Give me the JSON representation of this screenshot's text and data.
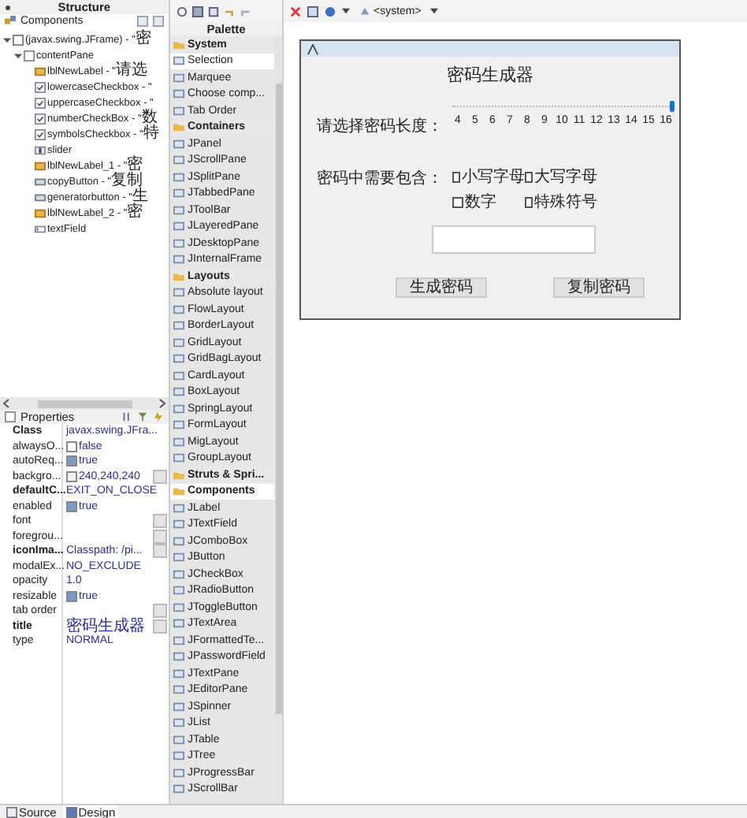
{
  "structure": {
    "title": "Structure",
    "components_label": "Components",
    "tree": [
      {
        "kind": "frame",
        "name": "(javax.swing.JFrame) - \"",
        "text": "密",
        "expanded": true,
        "children": [
          {
            "kind": "panel",
            "name": "contentPane",
            "expanded": true,
            "children": [
              {
                "kind": "label",
                "name": "lblNewLabel - \"",
                "text": "请选"
              },
              {
                "kind": "checkbox",
                "name": "lowercaseCheckbox - \""
              },
              {
                "kind": "checkbox",
                "name": "uppercaseCheckbox - \""
              },
              {
                "kind": "checkbox",
                "name": "numberCheckBox - \"",
                "text": "数"
              },
              {
                "kind": "checkbox",
                "name": "symbolsCheckbox - \"",
                "text": "特"
              },
              {
                "kind": "slider",
                "name": "slider"
              },
              {
                "kind": "label",
                "name": "lblNewLabel_1 - \"",
                "text": "密"
              },
              {
                "kind": "button",
                "name": "copyButton - \"",
                "text": "复制"
              },
              {
                "kind": "button",
                "name": "generatorbutton - \"",
                "text": "生"
              },
              {
                "kind": "label",
                "name": "lblNewLabel_2 - \"",
                "text": "密"
              },
              {
                "kind": "textfield",
                "name": "textField"
              }
            ]
          }
        ]
      }
    ]
  },
  "properties": {
    "title": "Properties",
    "rows": [
      {
        "name": "Class",
        "value": "javax.swing.JFra...",
        "bold": true,
        "kind": "text",
        "button": false
      },
      {
        "name": "alwaysO...",
        "value": "false",
        "bold": false,
        "kind": "check",
        "checked": false,
        "button": false
      },
      {
        "name": "autoReq...",
        "value": "true",
        "bold": false,
        "kind": "check",
        "checked": true,
        "button": false
      },
      {
        "name": "backgro...",
        "value": "240,240,240",
        "bold": false,
        "kind": "color",
        "button": true
      },
      {
        "name": "defaultC...",
        "value": "EXIT_ON_CLOSE",
        "bold": true,
        "kind": "text",
        "button": false
      },
      {
        "name": "enabled",
        "value": "true",
        "bold": false,
        "kind": "check",
        "checked": true,
        "button": false
      },
      {
        "name": "font",
        "bold": false,
        "kind": "text",
        "button": true
      },
      {
        "name": "foregrou...",
        "bold": false,
        "kind": "text",
        "button": true
      },
      {
        "name": "iconIma...",
        "value": "Classpath: /pi...",
        "bold": true,
        "kind": "text",
        "button": true
      },
      {
        "name": "modalEx...",
        "value": "NO_EXCLUDE",
        "bold": false,
        "kind": "text",
        "button": false
      },
      {
        "name": "opacity",
        "value": "1.0",
        "bold": false,
        "kind": "text",
        "button": false
      },
      {
        "name": "resizable",
        "value": "true",
        "bold": false,
        "kind": "check",
        "checked": true,
        "button": false
      },
      {
        "name": "tab order",
        "bold": false,
        "kind": "text",
        "button": true
      },
      {
        "name": "title",
        "value": "密码生成器",
        "bold": true,
        "kind": "text",
        "button": true
      },
      {
        "name": "type",
        "value": "NORMAL",
        "bold": false,
        "kind": "text",
        "button": false
      }
    ]
  },
  "palette": {
    "title": "Palette",
    "items": [
      {
        "kind": "category",
        "label": "System",
        "selected": false
      },
      {
        "kind": "tool",
        "label": "Selection",
        "selected": true
      },
      {
        "kind": "tool",
        "label": "Marquee",
        "selected": false
      },
      {
        "kind": "tool",
        "label": "Choose comp...",
        "selected": false
      },
      {
        "kind": "tool",
        "label": "Tab Order",
        "selected": false
      },
      {
        "kind": "category",
        "label": "Containers",
        "selected": false
      },
      {
        "kind": "tool",
        "label": "JPanel",
        "selected": false
      },
      {
        "kind": "tool",
        "label": "JScrollPane",
        "selected": false
      },
      {
        "kind": "tool",
        "label": "JSplitPane",
        "selected": false
      },
      {
        "kind": "tool",
        "label": "JTabbedPane",
        "selected": false
      },
      {
        "kind": "tool",
        "label": "JToolBar",
        "selected": false
      },
      {
        "kind": "tool",
        "label": "JLayeredPane",
        "selected": false
      },
      {
        "kind": "tool",
        "label": "JDesktopPane",
        "selected": false
      },
      {
        "kind": "tool",
        "label": "JInternalFrame",
        "selected": false
      },
      {
        "kind": "category",
        "label": "Layouts",
        "selected": false
      },
      {
        "kind": "tool",
        "label": "Absolute layout",
        "selected": false
      },
      {
        "kind": "tool",
        "label": "FlowLayout",
        "selected": false
      },
      {
        "kind": "tool",
        "label": "BorderLayout",
        "selected": false
      },
      {
        "kind": "tool",
        "label": "GridLayout",
        "selected": false
      },
      {
        "kind": "tool",
        "label": "GridBagLayout",
        "selected": false
      },
      {
        "kind": "tool",
        "label": "CardLayout",
        "selected": false
      },
      {
        "kind": "tool",
        "label": "BoxLayout",
        "selected": false
      },
      {
        "kind": "tool",
        "label": "SpringLayout",
        "selected": false
      },
      {
        "kind": "tool",
        "label": "FormLayout",
        "selected": false
      },
      {
        "kind": "tool",
        "label": "MigLayout",
        "selected": false
      },
      {
        "kind": "tool",
        "label": "GroupLayout",
        "selected": false
      },
      {
        "kind": "category",
        "label": "Struts & Spri...",
        "selected": false
      },
      {
        "kind": "category",
        "label": "Components",
        "selected": true
      },
      {
        "kind": "tool",
        "label": "JLabel",
        "selected": false
      },
      {
        "kind": "tool",
        "label": "JTextField",
        "selected": false
      },
      {
        "kind": "tool",
        "label": "JComboBox",
        "selected": false
      },
      {
        "kind": "tool",
        "label": "JButton",
        "selected": false
      },
      {
        "kind": "tool",
        "label": "JCheckBox",
        "selected": false
      },
      {
        "kind": "tool",
        "label": "JRadioButton",
        "selected": false
      },
      {
        "kind": "tool",
        "label": "JToggleButton",
        "selected": false
      },
      {
        "kind": "tool",
        "label": "JTextArea",
        "selected": false
      },
      {
        "kind": "tool",
        "label": "JFormattedTe...",
        "selected": false
      },
      {
        "kind": "tool",
        "label": "JPasswordField",
        "selected": false
      },
      {
        "kind": "tool",
        "label": "JTextPane",
        "selected": false
      },
      {
        "kind": "tool",
        "label": "JEditorPane",
        "selected": false
      },
      {
        "kind": "tool",
        "label": "JSpinner",
        "selected": false
      },
      {
        "kind": "tool",
        "label": "JList",
        "selected": false
      },
      {
        "kind": "tool",
        "label": "JTable",
        "selected": false
      },
      {
        "kind": "tool",
        "label": "JTree",
        "selected": false
      },
      {
        "kind": "tool",
        "label": "JProgressBar",
        "selected": false
      },
      {
        "kind": "tool",
        "label": "JScrollBar",
        "selected": false
      }
    ]
  },
  "toolbar": {
    "lookandfeel": "<system>"
  },
  "design": {
    "title": "密码生成器",
    "length_label": "请选择密码长度：",
    "slider": {
      "level": 1.0,
      "ticks": [
        "4",
        "5",
        "6",
        "7",
        "8",
        "9",
        "10",
        "11",
        "12",
        "13",
        "14",
        "15",
        "16"
      ]
    },
    "include_label": "密码中需要包含：",
    "options": [
      {
        "label": "小写字母",
        "checked": false
      },
      {
        "label": "大写字母",
        "checked": false
      },
      {
        "label": "数字",
        "checked": false
      },
      {
        "label": "特殊符号",
        "checked": false
      }
    ],
    "buttons": [
      "生成密码",
      "复制密码"
    ]
  },
  "bottom_tabs": [
    {
      "label": "Source",
      "selected": false
    },
    {
      "label": "Design",
      "selected": true
    }
  ]
}
